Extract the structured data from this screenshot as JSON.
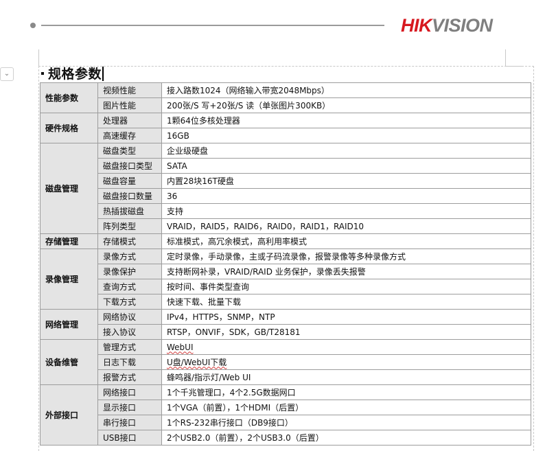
{
  "brand": {
    "part1": "HIK",
    "part2": "VISION",
    "color_red": "#d71920",
    "color_gray": "#7f7f7f"
  },
  "section_title": "规格参数",
  "groups": [
    {
      "name": "性能参数",
      "rows": [
        {
          "label": "视频性能",
          "value": "接入路数1024（网络输入带宽2048Mbps）"
        },
        {
          "label": "图片性能",
          "value": "200张/S 写+20张/S 读（单张图片300KB）"
        }
      ]
    },
    {
      "name": "硬件规格",
      "rows": [
        {
          "label": "处理器",
          "value": "1颗64位多核处理器"
        },
        {
          "label": "高速缓存",
          "value": "16GB"
        }
      ]
    },
    {
      "name": "磁盘管理",
      "rows": [
        {
          "label": "磁盘类型",
          "value": "企业级硬盘"
        },
        {
          "label": "磁盘接口类型",
          "value": "SATA"
        },
        {
          "label": "磁盘容量",
          "value": "内置28块16T硬盘"
        },
        {
          "label": "磁盘接口数量",
          "value": "36"
        },
        {
          "label": "热插拔磁盘",
          "value": "支持"
        },
        {
          "label": "阵列类型",
          "value": "VRAID，RAID5，RAID6，RAID0，RAID1，RAID10"
        }
      ]
    },
    {
      "name": "存储管理",
      "rows": [
        {
          "label": "存储模式",
          "value": "标准模式，高冗余模式，高利用率模式"
        }
      ]
    },
    {
      "name": "录像管理",
      "rows": [
        {
          "label": "录像方式",
          "value": "定时录像，手动录像，主或子码流录像，报警录像等多种录像方式"
        },
        {
          "label": "录像保护",
          "value": "支持断网补录，VRAID/RAID 业务保护，录像丢失报警"
        },
        {
          "label": "查询方式",
          "value": "按时间、事件类型查询"
        },
        {
          "label": "下载方式",
          "value": "快速下载、批量下载"
        }
      ]
    },
    {
      "name": "网络管理",
      "rows": [
        {
          "label": "网络协议",
          "value": "IPv4，HTTPS，SNMP，NTP"
        },
        {
          "label": "接入协议",
          "value": "RTSP，ONVIF，SDK，GB/T28181"
        }
      ]
    },
    {
      "name": "设备维管",
      "rows": [
        {
          "label": "管理方式",
          "value": "WebUI",
          "squiggle": true
        },
        {
          "label": "日志下载",
          "value": "U盘/WebUI下载",
          "squiggle": true
        },
        {
          "label": "报警方式",
          "value": "蜂鸣器/指示灯/Web UI"
        }
      ]
    },
    {
      "name": "外部接口",
      "rows": [
        {
          "label": "网络接口",
          "value": "1个千兆管理口，4个2.5G数据网口"
        },
        {
          "label": "显示接口",
          "value": "1个VGA（前置），1个HDMI（后置）"
        },
        {
          "label": "串行接口",
          "value": "1个RS-232串行接口（DB9接口）"
        },
        {
          "label": "USB接口",
          "value": "2个USB2.0（前置），2个USB3.0（后置）"
        }
      ]
    }
  ]
}
